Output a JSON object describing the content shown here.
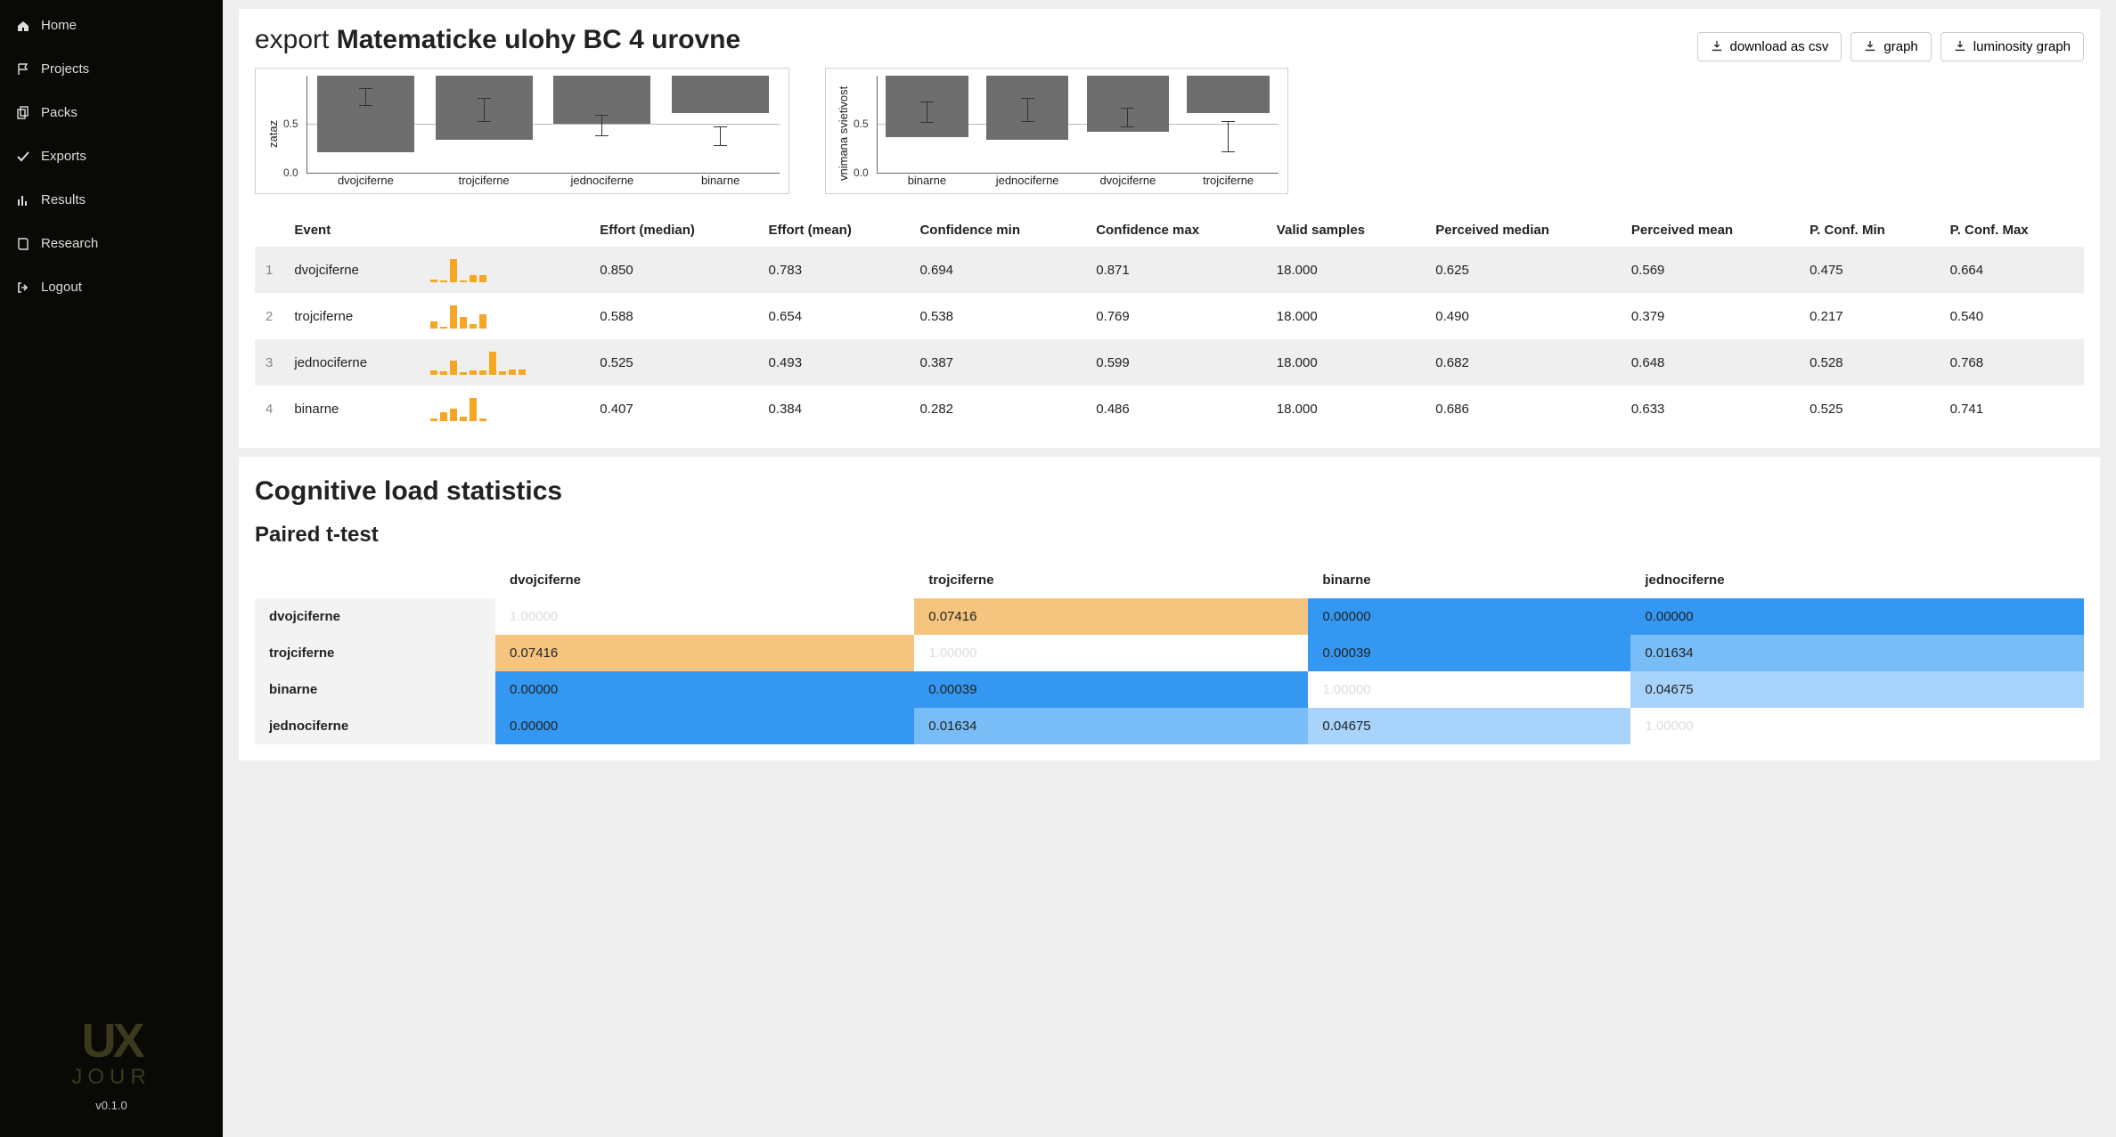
{
  "sidebar": {
    "items": [
      {
        "label": "Home",
        "icon": "home"
      },
      {
        "label": "Projects",
        "icon": "flag"
      },
      {
        "label": "Packs",
        "icon": "copy"
      },
      {
        "label": "Exports",
        "icon": "check"
      },
      {
        "label": "Results",
        "icon": "bars"
      },
      {
        "label": "Research",
        "icon": "book"
      },
      {
        "label": "Logout",
        "icon": "signout"
      }
    ],
    "logo1": "UX",
    "logo2": "JOUR",
    "version": "v0.1.0"
  },
  "header": {
    "prefix": "export",
    "title": "Matematicke ulohy BC 4 urovne",
    "buttons": {
      "csv": "download as csv",
      "graph": "graph",
      "lum": "luminosity graph"
    }
  },
  "chart_data": [
    {
      "type": "bar",
      "ylabel": "zataz",
      "ylim": [
        0,
        1
      ],
      "yticks": [
        0.0,
        0.5
      ],
      "categories": [
        "dvojciferne",
        "trojciferne",
        "jednociferne",
        "binarne"
      ],
      "values": [
        0.78,
        0.65,
        0.49,
        0.38
      ],
      "errors": [
        0.09,
        0.12,
        0.11,
        0.1
      ]
    },
    {
      "type": "bar",
      "ylabel": "vnimana svietivost",
      "ylim": [
        0,
        1
      ],
      "yticks": [
        0.0,
        0.5
      ],
      "categories": [
        "binarne",
        "jednociferne",
        "dvojciferne",
        "trojciferne"
      ],
      "values": [
        0.63,
        0.65,
        0.57,
        0.38
      ],
      "errors": [
        0.11,
        0.12,
        0.1,
        0.16
      ]
    }
  ],
  "table": {
    "headers": [
      "Event",
      "Effort (median)",
      "Effort (mean)",
      "Confidence min",
      "Confidence max",
      "Valid samples",
      "Perceived median",
      "Perceived mean",
      "P. Conf. Min",
      "P. Conf. Max"
    ],
    "rows": [
      {
        "n": "1",
        "event": "dvojciferne",
        "spark": [
          0.1,
          0.05,
          1.0,
          0.05,
          0.3,
          0.3
        ],
        "vals": [
          "0.850",
          "0.783",
          "0.694",
          "0.871",
          "18.000",
          "0.625",
          "0.569",
          "0.475",
          "0.664"
        ]
      },
      {
        "n": "2",
        "event": "trojciferne",
        "spark": [
          0.3,
          0.05,
          1.0,
          0.5,
          0.2,
          0.6
        ],
        "vals": [
          "0.588",
          "0.654",
          "0.538",
          "0.769",
          "18.000",
          "0.490",
          "0.379",
          "0.217",
          "0.540"
        ]
      },
      {
        "n": "3",
        "event": "jednociferne",
        "spark": [
          0.2,
          0.15,
          0.6,
          0.1,
          0.2,
          0.2,
          1.0,
          0.15,
          0.25,
          0.25
        ],
        "vals": [
          "0.525",
          "0.493",
          "0.387",
          "0.599",
          "18.000",
          "0.682",
          "0.648",
          "0.528",
          "0.768"
        ]
      },
      {
        "n": "4",
        "event": "binarne",
        "spark": [
          0.1,
          0.4,
          0.55,
          0.2,
          1.0,
          0.1
        ],
        "vals": [
          "0.407",
          "0.384",
          "0.282",
          "0.486",
          "18.000",
          "0.686",
          "0.633",
          "0.525",
          "0.741"
        ]
      }
    ]
  },
  "stats": {
    "title": "Cognitive load statistics",
    "subtitle": "Paired t-test",
    "cols": [
      "dvojciferne",
      "trojciferne",
      "binarne",
      "jednociferne"
    ],
    "grid": [
      {
        "name": "dvojciferne",
        "cells": [
          {
            "v": "1.00000",
            "c": "c-diag"
          },
          {
            "v": "0.07416",
            "c": "c-or"
          },
          {
            "v": "0.00000",
            "c": "c-b1"
          },
          {
            "v": "0.00000",
            "c": "c-b1"
          }
        ]
      },
      {
        "name": "trojciferne",
        "cells": [
          {
            "v": "0.07416",
            "c": "c-or"
          },
          {
            "v": "1.00000",
            "c": "c-diag"
          },
          {
            "v": "0.00039",
            "c": "c-b1"
          },
          {
            "v": "0.01634",
            "c": "c-b2"
          }
        ]
      },
      {
        "name": "binarne",
        "cells": [
          {
            "v": "0.00000",
            "c": "c-b1"
          },
          {
            "v": "0.00039",
            "c": "c-b1"
          },
          {
            "v": "1.00000",
            "c": "c-diag"
          },
          {
            "v": "0.04675",
            "c": "c-b3"
          }
        ]
      },
      {
        "name": "jednociferne",
        "cells": [
          {
            "v": "0.00000",
            "c": "c-b1"
          },
          {
            "v": "0.01634",
            "c": "c-b2"
          },
          {
            "v": "0.04675",
            "c": "c-b3"
          },
          {
            "v": "1.00000",
            "c": "c-diag"
          }
        ]
      }
    ]
  }
}
